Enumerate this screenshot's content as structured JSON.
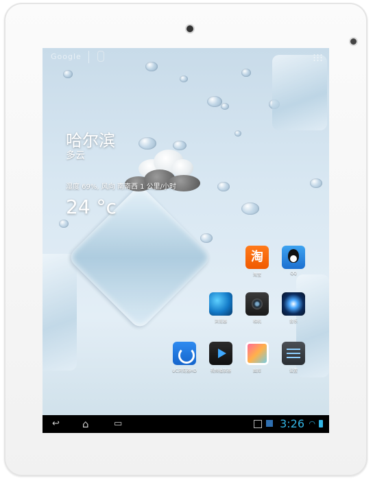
{
  "search_widget": {
    "brand": "Google",
    "divider": "|"
  },
  "weather": {
    "city": "哈尔滨",
    "condition": "多云",
    "details": "湿度 69%, 风向 南南西 1 公里/小时",
    "temperature": "24 °c"
  },
  "apps": [
    {
      "label": "淘宝",
      "glyph": "淘",
      "icon": "taobao-icon"
    },
    {
      "label": "QQ",
      "glyph": "",
      "icon": "qq-penguin-icon"
    },
    {
      "label": "浏览器",
      "glyph": "",
      "icon": "browser-globe-icon"
    },
    {
      "label": "相机",
      "glyph": "",
      "icon": "camera-icon"
    },
    {
      "label": "音乐",
      "glyph": "",
      "icon": "music-speaker-icon"
    },
    {
      "label": "UC浏览器HD",
      "glyph": "",
      "icon": "uc-browser-icon"
    },
    {
      "label": "视频播放器",
      "glyph": "",
      "icon": "video-player-icon"
    },
    {
      "label": "图库",
      "glyph": "",
      "icon": "gallery-icon"
    },
    {
      "label": "设置",
      "glyph": "",
      "icon": "settings-icon"
    }
  ],
  "navigation": {
    "back_glyph": "↩",
    "home_glyph": "⌂",
    "recents_glyph": "▭"
  },
  "status_bar": {
    "time": "3:26",
    "wifi_glyph": "◠"
  },
  "colors": {
    "status_accent": "#33b5e5",
    "bezel": "#f4f4f4",
    "navbar": "#000000"
  }
}
